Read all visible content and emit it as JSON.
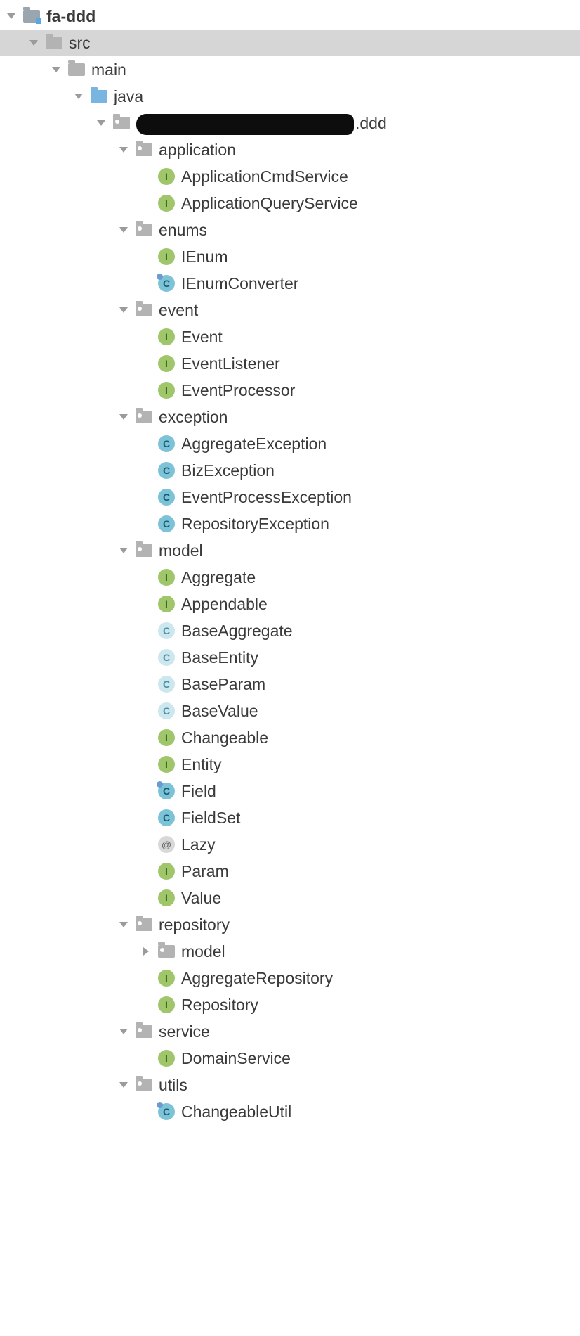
{
  "tree": [
    {
      "depth": 0,
      "expand": "open",
      "icon": "module",
      "label": "fa-ddd",
      "bold": true
    },
    {
      "depth": 1,
      "expand": "open",
      "icon": "folder-grey",
      "label": "src",
      "selected": true
    },
    {
      "depth": 2,
      "expand": "open",
      "icon": "folder-grey",
      "label": "main"
    },
    {
      "depth": 3,
      "expand": "open",
      "icon": "folder-blue",
      "label": "java"
    },
    {
      "depth": 4,
      "expand": "open",
      "icon": "pkg",
      "label": ".ddd",
      "redacted": true
    },
    {
      "depth": 5,
      "expand": "open",
      "icon": "pkg",
      "label": "application"
    },
    {
      "depth": 6,
      "expand": "none",
      "icon": "interface",
      "label": "ApplicationCmdService"
    },
    {
      "depth": 6,
      "expand": "none",
      "icon": "interface",
      "label": "ApplicationQueryService"
    },
    {
      "depth": 5,
      "expand": "open",
      "icon": "pkg",
      "label": "enums"
    },
    {
      "depth": 6,
      "expand": "none",
      "icon": "interface",
      "label": "IEnum"
    },
    {
      "depth": 6,
      "expand": "none",
      "icon": "class",
      "tick": true,
      "label": "IEnumConverter"
    },
    {
      "depth": 5,
      "expand": "open",
      "icon": "pkg",
      "label": "event"
    },
    {
      "depth": 6,
      "expand": "none",
      "icon": "interface",
      "label": "Event"
    },
    {
      "depth": 6,
      "expand": "none",
      "icon": "interface",
      "label": "EventListener"
    },
    {
      "depth": 6,
      "expand": "none",
      "icon": "interface",
      "label": "EventProcessor"
    },
    {
      "depth": 5,
      "expand": "open",
      "icon": "pkg",
      "label": "exception"
    },
    {
      "depth": 6,
      "expand": "none",
      "icon": "class",
      "label": "AggregateException"
    },
    {
      "depth": 6,
      "expand": "none",
      "icon": "class",
      "label": "BizException"
    },
    {
      "depth": 6,
      "expand": "none",
      "icon": "class",
      "label": "EventProcessException"
    },
    {
      "depth": 6,
      "expand": "none",
      "icon": "class",
      "label": "RepositoryException"
    },
    {
      "depth": 5,
      "expand": "open",
      "icon": "pkg",
      "label": "model"
    },
    {
      "depth": 6,
      "expand": "none",
      "icon": "interface",
      "label": "Aggregate"
    },
    {
      "depth": 6,
      "expand": "none",
      "icon": "interface",
      "label": "Appendable"
    },
    {
      "depth": 6,
      "expand": "none",
      "icon": "abstract",
      "label": "BaseAggregate"
    },
    {
      "depth": 6,
      "expand": "none",
      "icon": "abstract",
      "label": "BaseEntity"
    },
    {
      "depth": 6,
      "expand": "none",
      "icon": "abstract",
      "label": "BaseParam"
    },
    {
      "depth": 6,
      "expand": "none",
      "icon": "abstract",
      "label": "BaseValue"
    },
    {
      "depth": 6,
      "expand": "none",
      "icon": "interface",
      "label": "Changeable"
    },
    {
      "depth": 6,
      "expand": "none",
      "icon": "interface",
      "label": "Entity"
    },
    {
      "depth": 6,
      "expand": "none",
      "icon": "class",
      "tick": true,
      "label": "Field"
    },
    {
      "depth": 6,
      "expand": "none",
      "icon": "class",
      "label": "FieldSet"
    },
    {
      "depth": 6,
      "expand": "none",
      "icon": "annotation",
      "label": "Lazy"
    },
    {
      "depth": 6,
      "expand": "none",
      "icon": "interface",
      "label": "Param"
    },
    {
      "depth": 6,
      "expand": "none",
      "icon": "interface",
      "label": "Value"
    },
    {
      "depth": 5,
      "expand": "open",
      "icon": "pkg",
      "label": "repository"
    },
    {
      "depth": 6,
      "expand": "closed",
      "icon": "pkg",
      "label": "model"
    },
    {
      "depth": 6,
      "expand": "none",
      "icon": "interface",
      "label": "AggregateRepository"
    },
    {
      "depth": 6,
      "expand": "none",
      "icon": "interface",
      "label": "Repository"
    },
    {
      "depth": 5,
      "expand": "open",
      "icon": "pkg",
      "label": "service"
    },
    {
      "depth": 6,
      "expand": "none",
      "icon": "interface",
      "label": "DomainService"
    },
    {
      "depth": 5,
      "expand": "open",
      "icon": "pkg",
      "label": "utils"
    },
    {
      "depth": 6,
      "expand": "none",
      "icon": "class",
      "tick": true,
      "label": "ChangeableUtil"
    }
  ],
  "indentUnit": 32,
  "glyphs": {
    "interface": "I",
    "class": "C",
    "abstract": "C",
    "annotation": "@"
  }
}
